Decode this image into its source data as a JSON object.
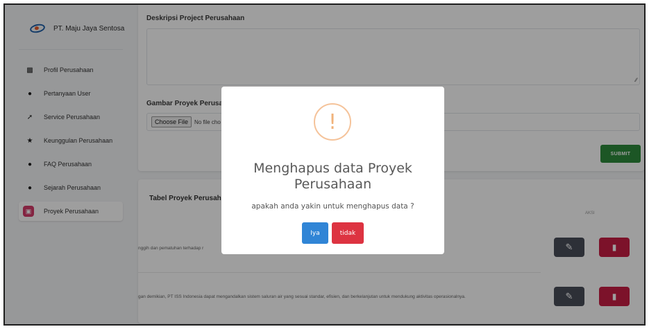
{
  "sidebar": {
    "brand": "PT. Maju Jaya Sentosa",
    "items": [
      {
        "label": "Profil Perusahaan",
        "icon": "building-icon"
      },
      {
        "label": "Pertanyaan User",
        "icon": "user-circle-icon"
      },
      {
        "label": "Service Perusahaan",
        "icon": "wrench-icon"
      },
      {
        "label": "Keunggulan Perusahaan",
        "icon": "star-icon"
      },
      {
        "label": "FAQ Perusahaan",
        "icon": "question-icon"
      },
      {
        "label": "Sejarah Perusahaan",
        "icon": "history-icon"
      },
      {
        "label": "Proyek Perusahaan",
        "icon": "briefcase-icon",
        "active": true
      }
    ]
  },
  "form": {
    "description_label": "Deskripsi Project Perusahaan",
    "image_label": "Gambar Proyek Perusa",
    "choose_file": "Choose File",
    "no_file": "No file cho",
    "submit": "SUBMIT"
  },
  "table": {
    "title": "Tabel Proyek Perusah",
    "column_action": "AKSI",
    "rows": [
      {
        "text": "nggih dan pematuhan terhadap r"
      },
      {
        "text": "gan demikian, PT ISS Indonesia dapat mengandalkan sistem saluran air yang sesuai standar, efisien, dan berkelanjutan untuk mendukung aktivitas operasionalnya."
      }
    ]
  },
  "modal": {
    "icon_glyph": "!",
    "title": "Menghapus data Proyek Perusahaan",
    "text": "apakah anda yakin untuk menghapus data ?",
    "confirm": "Iya",
    "cancel": "tidak"
  },
  "colors": {
    "accent_active": "#d63a6a",
    "submit": "#2e8b3c",
    "edit": "#4a4e5a",
    "delete": "#c81e45",
    "confirm": "#3085d6",
    "cancel": "#dd3341",
    "warning": "#f0b27a"
  }
}
